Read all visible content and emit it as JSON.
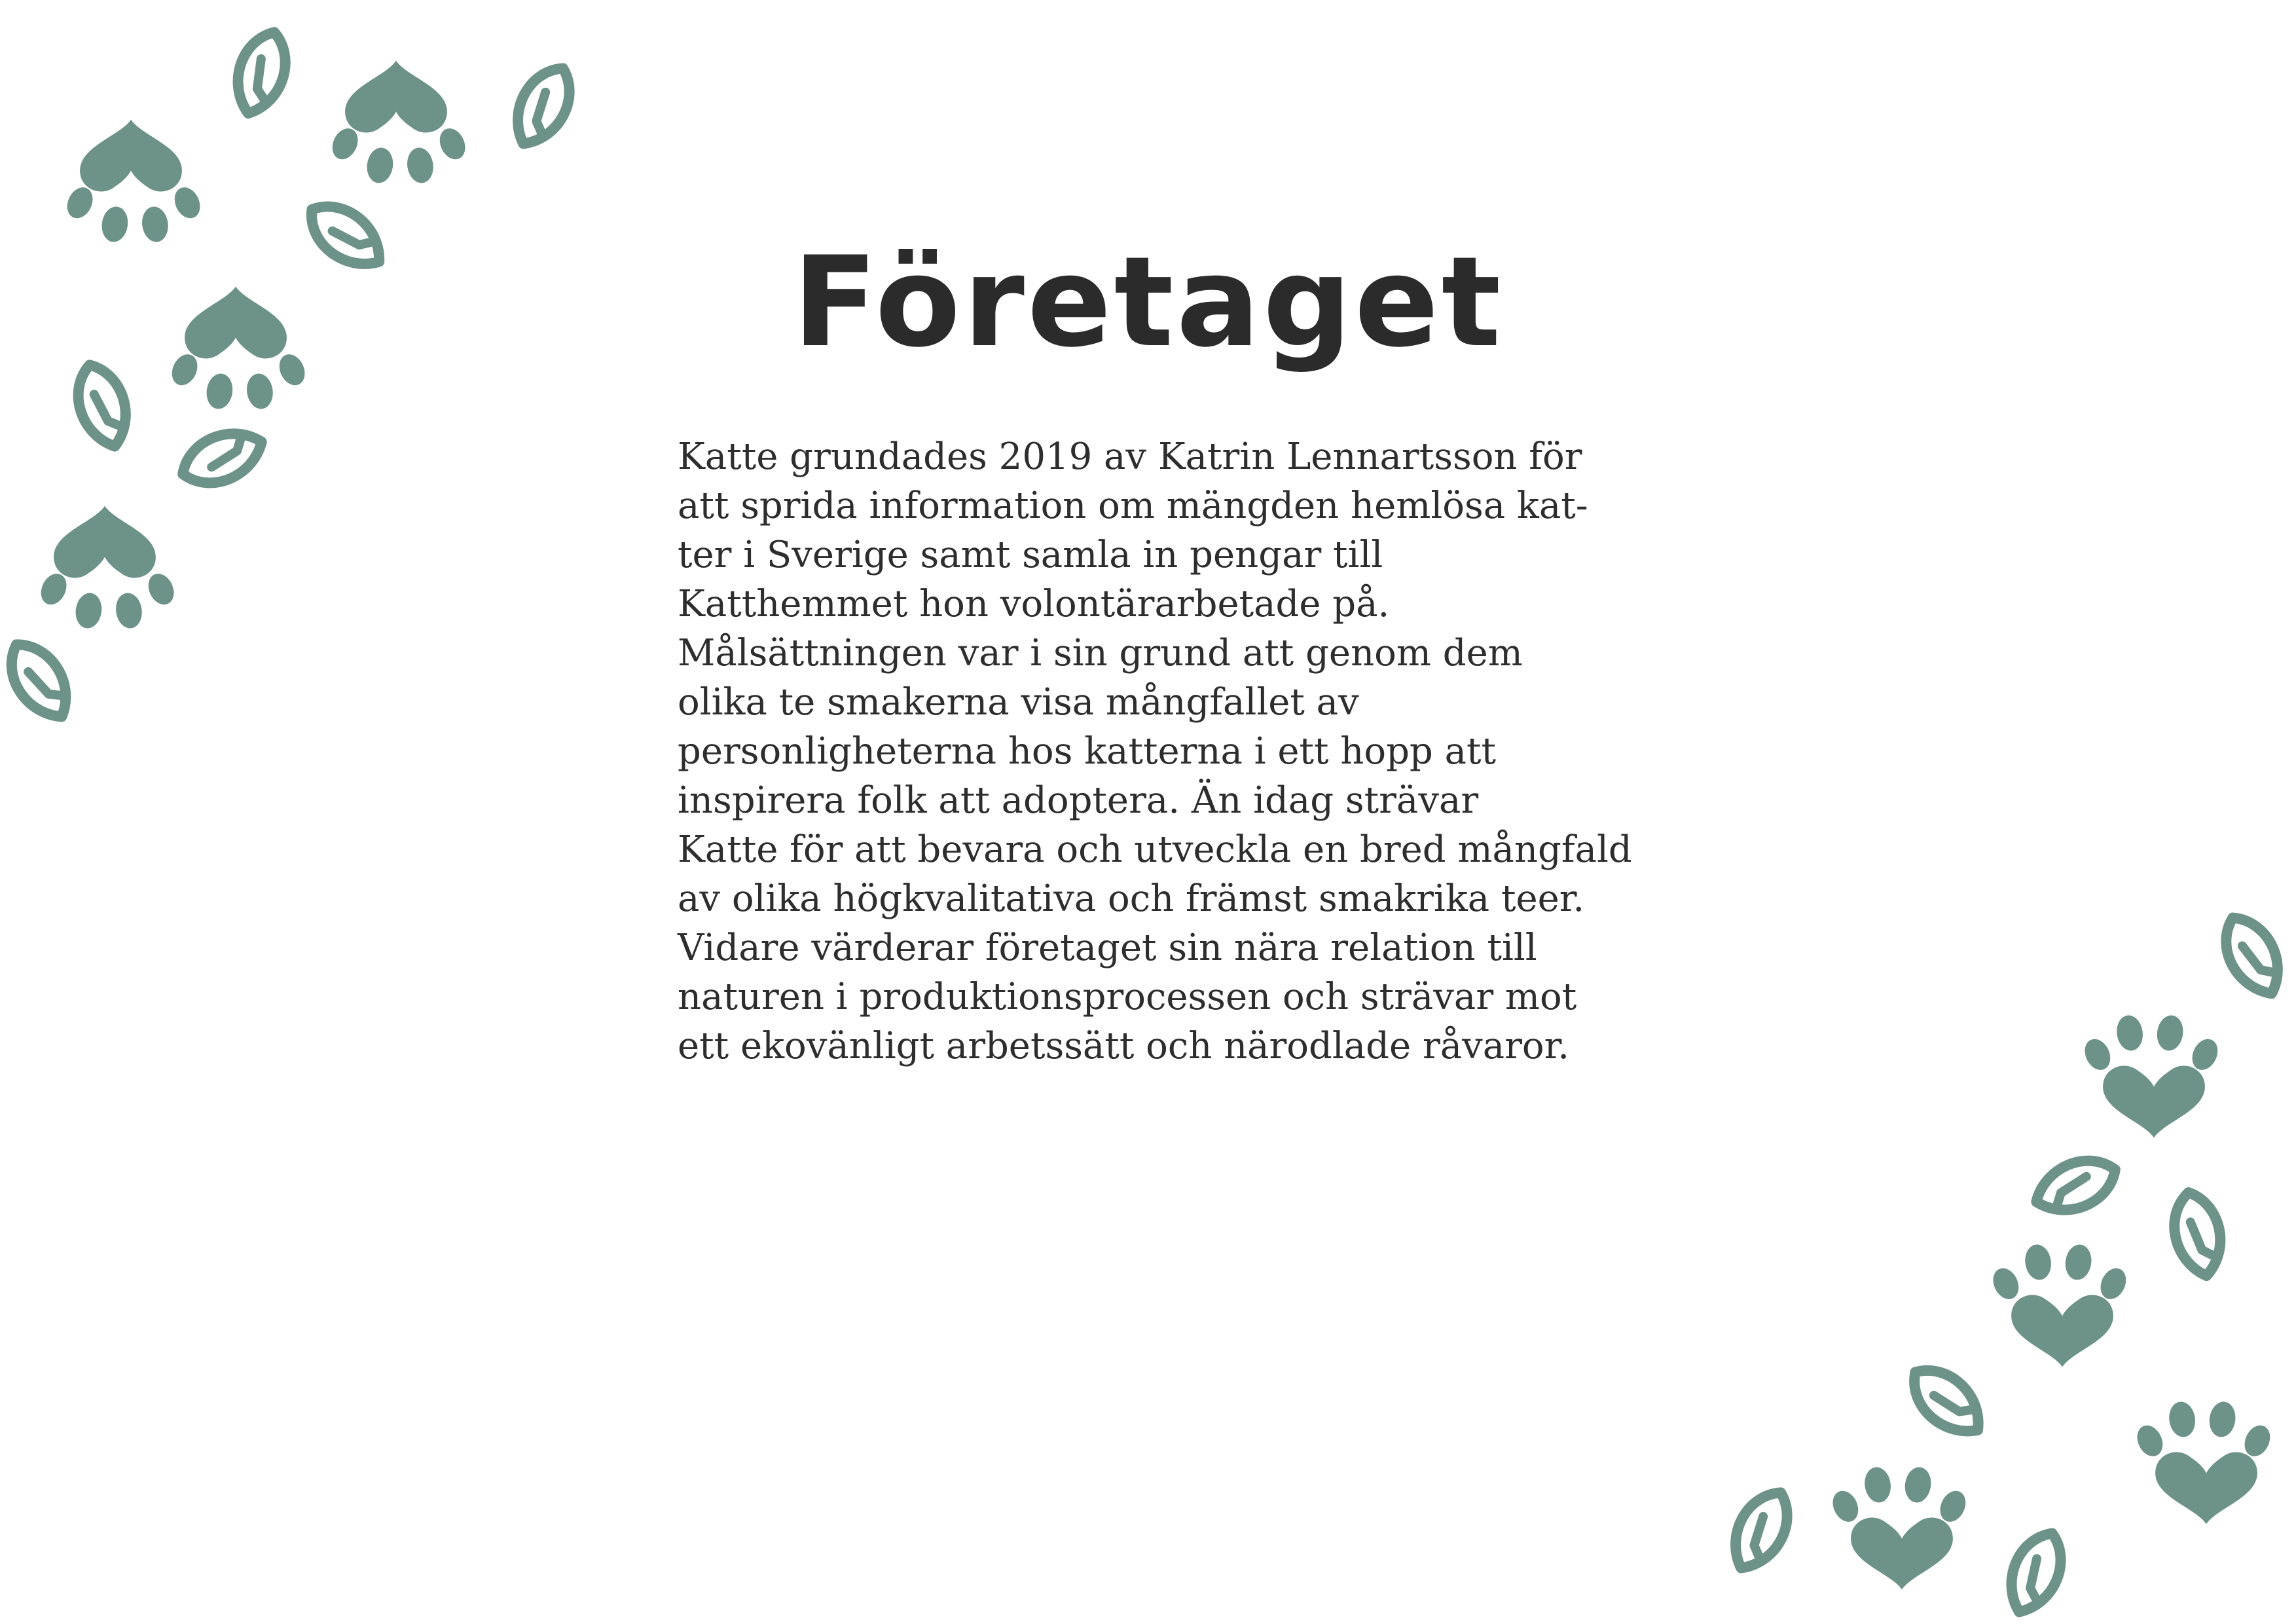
{
  "page": {
    "title": "Företaget",
    "body_lines": [
      "Katte grundades 2019 av Katrin Lennartsson för",
      "att sprida information om mängden hemlösa kat-",
      "ter i Sverige samt samla in pengar till",
      "Katthemmet hon volontärarbetade på.",
      "Målsättningen var i sin grund att genom dem",
      "olika te smakerna visa mångfallet av",
      "personligheterna hos katterna i ett hopp att",
      "inspirera folk att adoptera. Än idag strävar",
      "Katte för att bevara och utveckla en bred mångfald",
      "av olika högkvalitativa och främst smakrika teer.",
      "Vidare värderar företaget sin nära relation till",
      "naturen i produktionsprocessen och strävar mot",
      "ett ekovänligt arbetssätt och närodlade råvaror."
    ]
  },
  "colors": {
    "decoration": "#6d9289",
    "text": "#2d2d2d",
    "background": "#ffffff"
  },
  "decorations": {
    "paw_icon": "paw-print-icon",
    "leaf_icon": "leaf-outline-icon"
  }
}
